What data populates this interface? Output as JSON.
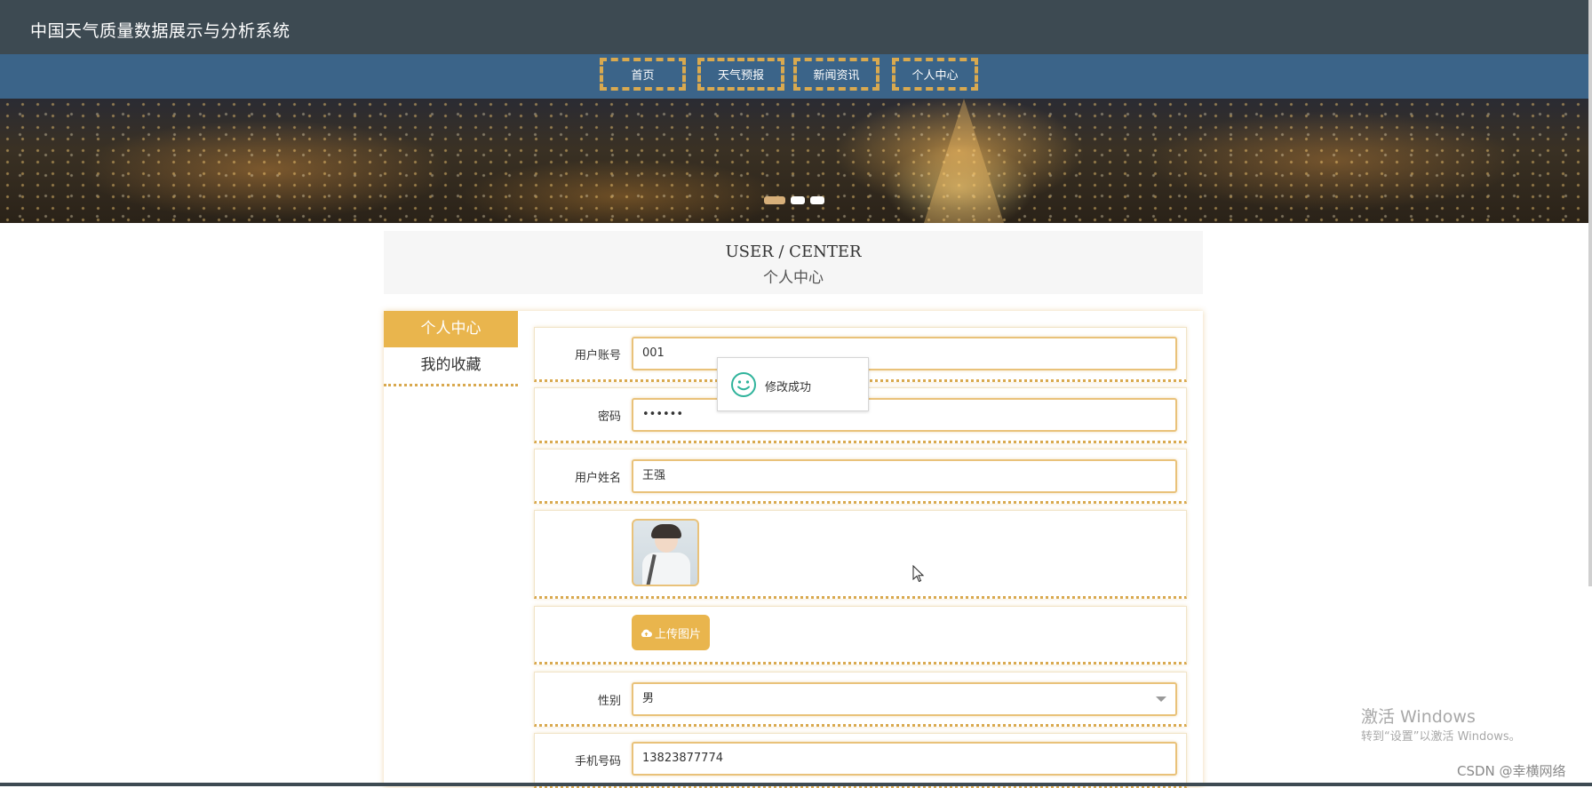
{
  "header": {
    "site_title": "中国天气质量数据展示与分析系统"
  },
  "nav": {
    "items": [
      {
        "label": "首页"
      },
      {
        "label": "天气预报"
      },
      {
        "label": "新闻资讯"
      },
      {
        "label": "个人中心"
      }
    ]
  },
  "banner": {
    "slide_count": 3,
    "active_slide": 1
  },
  "page_title": {
    "en": "USER / CENTER",
    "cn": "个人中心"
  },
  "sidebar": {
    "items": [
      {
        "label": "个人中心",
        "active": true
      },
      {
        "label": "我的收藏",
        "active": false
      }
    ]
  },
  "form": {
    "account": {
      "label": "用户账号",
      "value": "001"
    },
    "password": {
      "label": "密码",
      "value": "••••••"
    },
    "name": {
      "label": "用户姓名",
      "value": "王强"
    },
    "avatar": {
      "icon": "avatar-photo"
    },
    "upload": {
      "label": "上传图片",
      "icon": "cloud-upload-icon"
    },
    "gender": {
      "label": "性别",
      "value": "男"
    },
    "phone": {
      "label": "手机号码",
      "value": "13823877774"
    }
  },
  "toast": {
    "message": "修改成功",
    "icon": "smile-icon",
    "color": "#2fb39b"
  },
  "colors": {
    "accent": "#e9b54d",
    "nav_bg": "#3b6489",
    "header_bg": "#3d4a52",
    "dashed_border": "#d9a94f"
  },
  "watermark": {
    "activate_title": "激活 Windows",
    "activate_sub": "转到“设置”以激活 Windows。",
    "csdn": "CSDN @幸横网络"
  }
}
